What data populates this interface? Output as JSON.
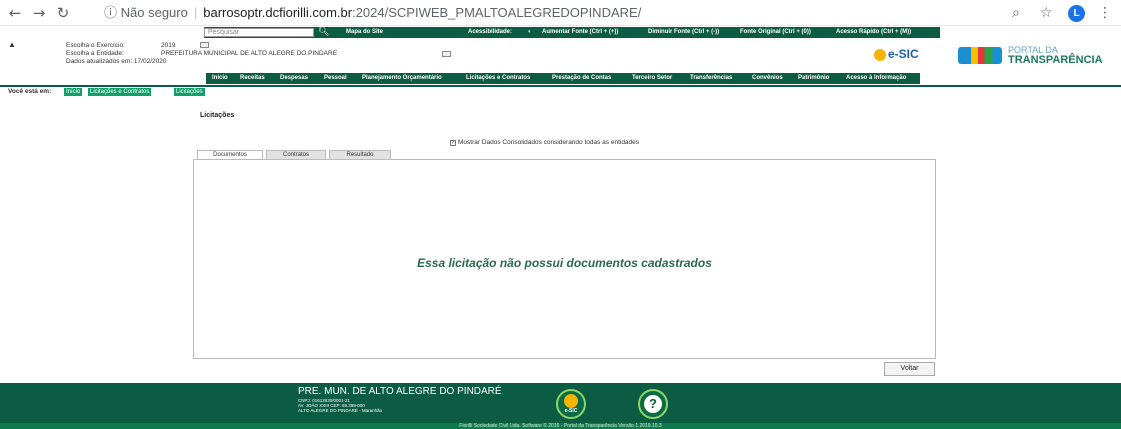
{
  "browser": {
    "security_label": "Não seguro",
    "url_host": "barrosoptr.dcfiorilli.com.br",
    "url_path": ":2024/SCPIWEB_PMALTOALEGREDOPINDARE/",
    "profile_initial": "L"
  },
  "topbar": {
    "search_placeholder": "Pesquisar",
    "sitemap": "Mapa do Site",
    "accessibility": "Acessibilidade:",
    "font_increase": "Aumentar Fonte (Ctrl + (+))",
    "font_decrease": "Diminuir Fonte (Ctrl + (-))",
    "font_original": "Fonte Original (Ctrl + (0))",
    "quick_access": "Acesso Rápido (Ctrl + (M))"
  },
  "header": {
    "exercise_label": "Escolha o Exercício:",
    "exercise_value": "2019",
    "entity_label": "Escolha a Entidade:",
    "entity_value": "PREFEITURA MUNICIPAL DE ALTO ALEGRE DO PINDARE",
    "updated": "Dados atualizados em: 17/02/2020",
    "esic_logo": "e-SIC",
    "portal_line1": "PORTAL DA",
    "portal_line2": "TRANSPARÊNCIA"
  },
  "menu": [
    "Início",
    "Receitas",
    "Despesas",
    "Pessoal",
    "Planejamento Orçamentário",
    "Licitações e Contratos",
    "Prestação de Contas",
    "Terceiro Setor",
    "Transferências",
    "Convênios",
    "Patrimônio",
    "Acesso à Informação"
  ],
  "breadcrumb": {
    "label": "Você está em:",
    "items": [
      "Início",
      "Licitações e Contratos",
      "Licitações"
    ]
  },
  "page": {
    "title": "Licitações",
    "consolidated": "Mostrar Dados Consolidados considerando todas as entidades",
    "tabs": [
      "Documentos",
      "Contratos",
      "Resultado"
    ],
    "empty_message": "Essa licitação não possui documentos cadastrados",
    "back_button": "Voltar"
  },
  "footer": {
    "title": "PRE. MUN. DE ALTO ALEGRE DO PINDARÉ",
    "cnpj": "CNPJ: 01612630/0001-21",
    "address": "AV. JOÃO XXIII CEP: 65.398-000",
    "city": "ALTO ALEGRE DO PINDARÉ - Maranhão",
    "esic_icon_label": "e-SIC",
    "help_icon_label": "?",
    "copyright": "Fiorilli Sociedade Civil Ltda. Software © 2016 - Portal da Transparência Versão 1.2019.10.3"
  }
}
